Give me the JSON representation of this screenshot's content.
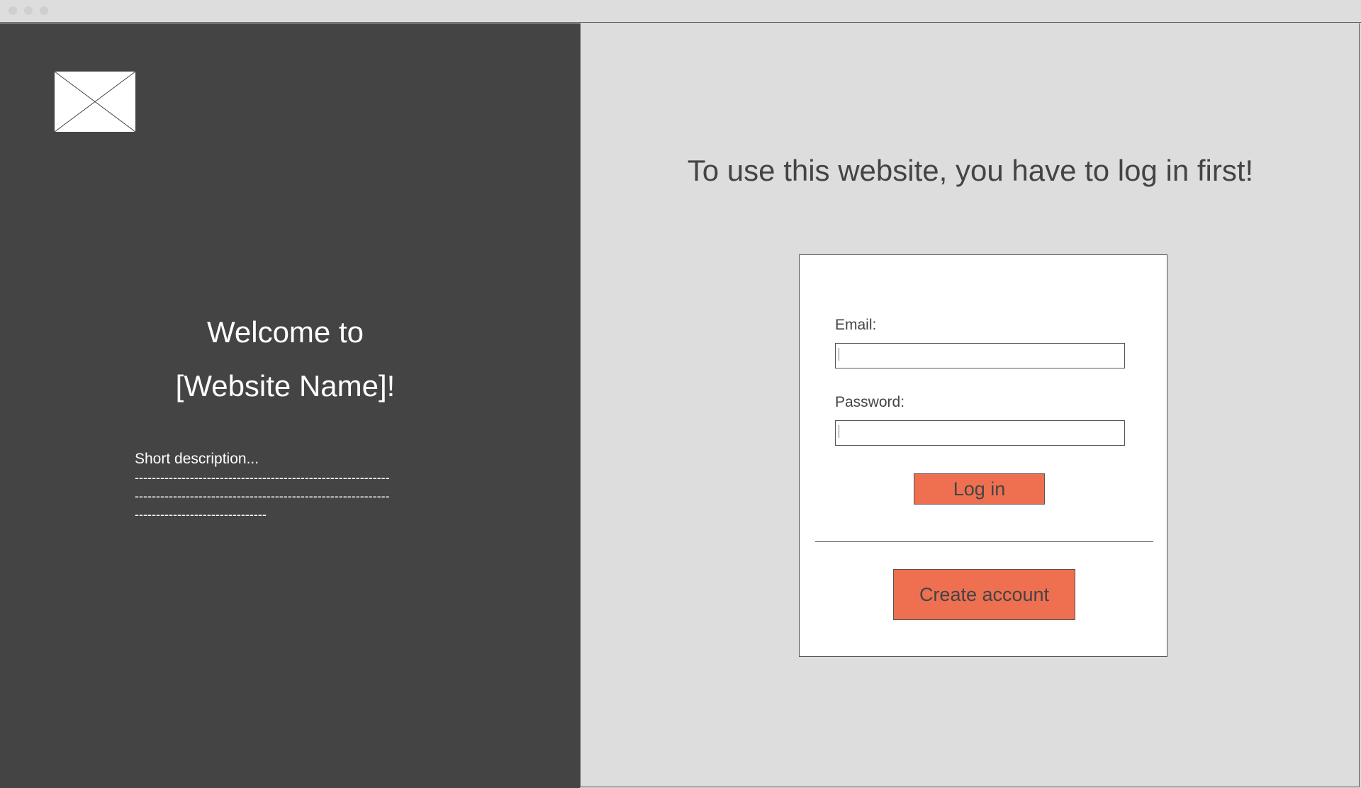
{
  "left": {
    "welcome_line1": "Welcome to",
    "welcome_line2": "[Website Name]!",
    "description_title": "Short description...",
    "description_lines": [
      "------------------------------------------------------------",
      "------------------------------------------------------------",
      "-------------------------------"
    ]
  },
  "right": {
    "headline": "To use this website, you have to log in first!",
    "form": {
      "email_label": "Email:",
      "email_value": "",
      "password_label": "Password:",
      "password_value": "",
      "login_label": "Log in",
      "create_account_label": "Create account"
    }
  },
  "colors": {
    "left_panel": "#444444",
    "background": "#dddddd",
    "accent_button": "#ee7051"
  },
  "icons": {
    "logo": "image-placeholder-icon"
  }
}
